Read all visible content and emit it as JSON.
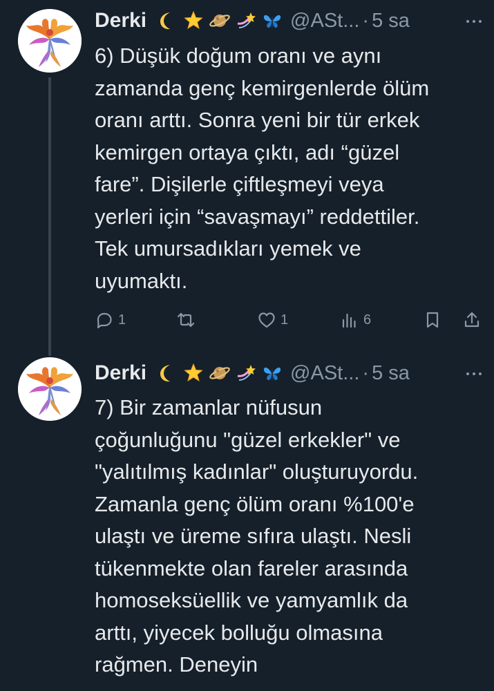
{
  "tweets": [
    {
      "author_name": "Derki",
      "author_handle": "@ASt...",
      "separator": "·",
      "time": "5 sa",
      "emojis": [
        "crescent-moon-icon",
        "glowing-star-icon",
        "ringed-planet-icon",
        "shooting-star-icon",
        "butterfly-icon"
      ],
      "text": "6) Düşük doğum oranı ve aynı\nzamanda genç kemirgenlerde ölüm\noranı arttı. Sonra yeni bir tür erkek\nkemirgen ortaya çıktı, adı “güzel\nfare”. Dişilerle çiftleşmeyi veya\nyerleri için “savaşmayı” reddettiler.\nTek umursadıkları yemek ve\nuyumaktı.",
      "replies": "1",
      "retweets": "",
      "likes": "1",
      "views": "6"
    },
    {
      "author_name": "Derki",
      "author_handle": "@ASt...",
      "separator": "·",
      "time": "5 sa",
      "emojis": [
        "crescent-moon-icon",
        "glowing-star-icon",
        "ringed-planet-icon",
        "shooting-star-icon",
        "butterfly-icon"
      ],
      "text": "7) Bir zamanlar nüfusun\nçoğunluğunu \"güzel erkekler\" ve\n\"yalıtılmış kadınlar\" oluşturuyordu.\nZamanla genç ölüm oranı %100'e\nulaştı ve üreme sıfıra ulaştı. Nesli\ntükenmekte olan fareler arasında\nhomoseksüellik ve yamyamlık da\narttı, yiyecek bolluğu olmasına\nrağmen. Deneyin"
    }
  ],
  "colors": {
    "background": "#15202b",
    "text": "#e7e9ea",
    "secondary": "#8b98a5",
    "thread_line": "#38444d"
  }
}
